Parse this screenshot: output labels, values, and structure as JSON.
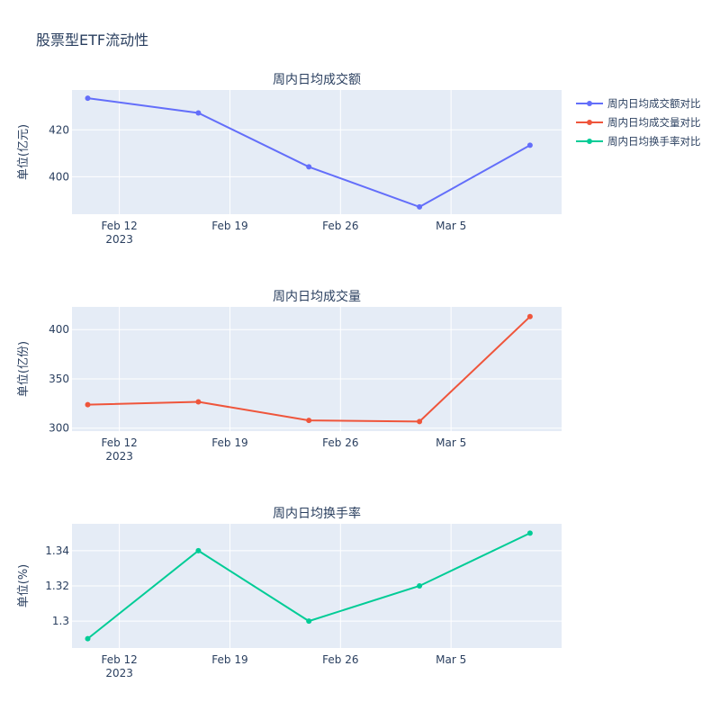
{
  "figure": {
    "title": "股票型ETF流动性"
  },
  "colors": {
    "plot_bg": "#E5ECF6",
    "grid": "#FFFFFF",
    "text": "#2a3f5f",
    "series": [
      "#636EFA",
      "#EF553B",
      "#00CC96"
    ]
  },
  "x_axis": {
    "tick_labels": [
      "Feb 12",
      "Feb 19",
      "Feb 26",
      "Mar 5"
    ],
    "year_label": "2023"
  },
  "legend": {
    "placement": "top-right",
    "items": [
      "周内日均成交额对比",
      "周内日均成交量对比",
      "周内日均换手率对比"
    ]
  },
  "chart_data": [
    {
      "type": "line",
      "title": "周内日均成交额",
      "series": [
        {
          "name": "周内日均成交额对比",
          "values": [
            433.5,
            427.2,
            404.2,
            387.1,
            413.4
          ]
        }
      ],
      "x": [
        "2023-02-10",
        "2023-02-17",
        "2023-02-24",
        "2023-03-03",
        "2023-03-10"
      ],
      "ylabel": "单位(亿元)",
      "xlim": [
        "2023-02-09",
        "2023-03-12"
      ],
      "ylim": [
        384,
        437
      ],
      "yticks": [
        400,
        420
      ],
      "ytick_labels": [
        "400",
        "420"
      ]
    },
    {
      "type": "line",
      "title": "周内日均成交量",
      "series": [
        {
          "name": "周内日均成交量对比",
          "values": [
            323.8,
            326.7,
            307.9,
            306.7,
            413.1
          ]
        }
      ],
      "x": [
        "2023-02-10",
        "2023-02-17",
        "2023-02-24",
        "2023-03-03",
        "2023-03-10"
      ],
      "ylabel": "单位(亿份)",
      "xlim": [
        "2023-02-09",
        "2023-03-12"
      ],
      "ylim": [
        297,
        423
      ],
      "yticks": [
        300,
        350,
        400
      ],
      "ytick_labels": [
        "300",
        "350",
        "400"
      ]
    },
    {
      "type": "line",
      "title": "周内日均换手率",
      "series": [
        {
          "name": "周内日均换手率对比",
          "values": [
            1.29,
            1.34,
            1.3,
            1.32,
            1.35
          ]
        }
      ],
      "x": [
        "2023-02-10",
        "2023-02-17",
        "2023-02-24",
        "2023-03-03",
        "2023-03-10"
      ],
      "ylabel": "单位(%)",
      "xlim": [
        "2023-02-09",
        "2023-03-12"
      ],
      "ylim": [
        1.2847,
        1.3553
      ],
      "yticks": [
        1.3,
        1.32,
        1.34
      ],
      "ytick_labels": [
        "1.3",
        "1.32",
        "1.34"
      ]
    }
  ]
}
